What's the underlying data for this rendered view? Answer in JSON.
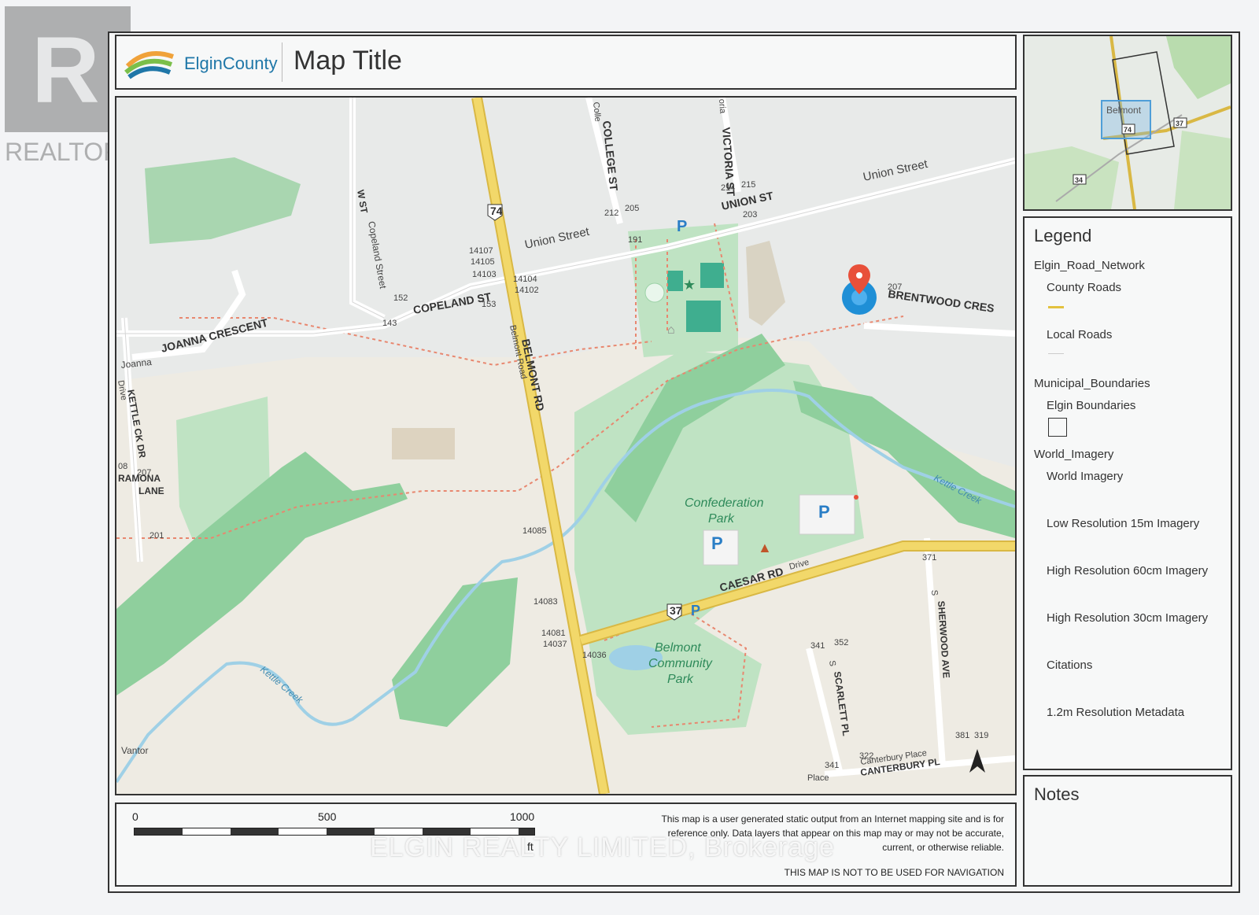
{
  "header": {
    "logo_brand": "ElginCounty",
    "map_title": "Map Title"
  },
  "watermarks": {
    "realtor": "REALTOR®",
    "brokerage": "ELGIN REALTY LIMITED, Brokerage"
  },
  "map": {
    "attribution": "Vantor",
    "roads": {
      "belmont_rd": "BELMONT RD",
      "belmont_road": "Belmont Road",
      "union_st": "UNION ST",
      "union_street_1": "Union Street",
      "union_street_2": "Union Street",
      "copeland_st": "COPELAND ST",
      "copeland_street": "Copeland Street",
      "w_st": "W ST",
      "college_st": "COLLEGE ST",
      "colle": "Colle",
      "victoria_st": "VICTORIA ST",
      "oria": "oria",
      "brentwood_cres": "BRENTWOOD CRES",
      "joanna_crescent": "JOANNA CRESCENT",
      "joanna": "Joanna",
      "kettle_ck_dr": "KETTLE CK DR",
      "drive": "Drive",
      "ramona_lane_1": "RAMONA",
      "ramona_lane_2": "LANE",
      "caesar_rd": "CAESAR RD",
      "caesar_drive": "Drive",
      "sherwood_ave": "SHERWOOD AVE",
      "sherwood_s": "S",
      "scarlett_pl": "SCARLETT PL",
      "scarlett_s": "S",
      "canterbury_pl": "CANTERBURY PL",
      "canterbury_place": "Canterbury Place",
      "place": "Place",
      "kettle_creek_1": "Kettle Creek",
      "kettle_creek_2": "Kettle Creek"
    },
    "shields": {
      "hwy_74": "74",
      "hwy_37": "37"
    },
    "parks": {
      "confederation_1": "Confederation",
      "confederation_2": "Park",
      "belmont_1": "Belmont",
      "belmont_2": "Community",
      "belmont_3": "Park"
    },
    "parking": "P",
    "address_numbers": {
      "n14107": "14107",
      "n14105": "14105",
      "n14103": "14103",
      "n14104": "14104",
      "n14102": "14102",
      "n152": "152",
      "n153": "153",
      "n143": "143",
      "n212": "212",
      "n205": "205",
      "n214": "214",
      "n215": "215",
      "n203": "203",
      "n191": "191",
      "n207a": "207",
      "n207b": "207",
      "n08": "08",
      "n201": "201",
      "n14085": "14085",
      "n14083": "14083",
      "n14081": "14081",
      "n14037": "14037",
      "n14036": "14036",
      "n371": "371",
      "n341a": "341",
      "n352": "352",
      "n381": "381",
      "n319": "319",
      "n341b": "341",
      "n322": "322"
    }
  },
  "overview": {
    "town": "Belmont",
    "shields": {
      "hwy_74": "74",
      "hwy_37": "37",
      "hwy_34": "34"
    }
  },
  "legend": {
    "title": "Legend",
    "items": [
      "Elgin_Road_Network",
      "County Roads",
      "Local Roads",
      "Municipal_Boundaries",
      "Elgin Boundaries",
      "World_Imagery",
      "World Imagery",
      "Low Resolution 15m Imagery",
      "High Resolution 60cm Imagery",
      "High Resolution 30cm Imagery",
      "Citations",
      "1.2m Resolution Metadata"
    ]
  },
  "notes": {
    "title": "Notes"
  },
  "footer": {
    "scale": {
      "tick_0": "0",
      "tick_500": "500",
      "tick_1000": "1000",
      "unit": "ft"
    },
    "disclaimer": "This map is a user generated static output from an Internet mapping site and is for reference only. Data layers that appear on this map may or may not be accurate, current, or otherwise reliable.",
    "navigation": "THIS MAP IS NOT TO BE USED FOR NAVIGATION"
  },
  "colors": {
    "park_green": "#bfe3c3",
    "wood_green": "#8fcf9d",
    "highway_yellow": "#f2d86a",
    "creek_blue": "#9fd0e6",
    "trail_red": "#e8876f",
    "marker_blue": "#1f8fd6"
  }
}
